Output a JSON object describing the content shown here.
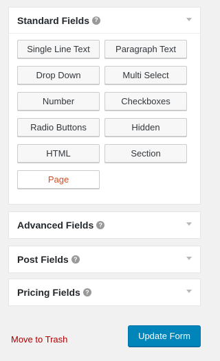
{
  "panels": {
    "standard": {
      "title": "Standard Fields",
      "buttons": [
        "Single Line Text",
        "Paragraph Text",
        "Drop Down",
        "Multi Select",
        "Number",
        "Checkboxes",
        "Radio Buttons",
        "Hidden",
        "HTML",
        "Section",
        "Page"
      ]
    },
    "advanced": {
      "title": "Advanced Fields"
    },
    "post": {
      "title": "Post Fields"
    },
    "pricing": {
      "title": "Pricing Fields"
    }
  },
  "help_glyph": "?",
  "actions": {
    "trash_label": "Move to Trash",
    "update_label": "Update Form"
  },
  "colors": {
    "accent": "#0085ba",
    "trash": "#aa0000",
    "page_button": "#d54e21"
  },
  "icons": {
    "help": "question-circle-icon",
    "toggle": "triangle-down-icon"
  }
}
